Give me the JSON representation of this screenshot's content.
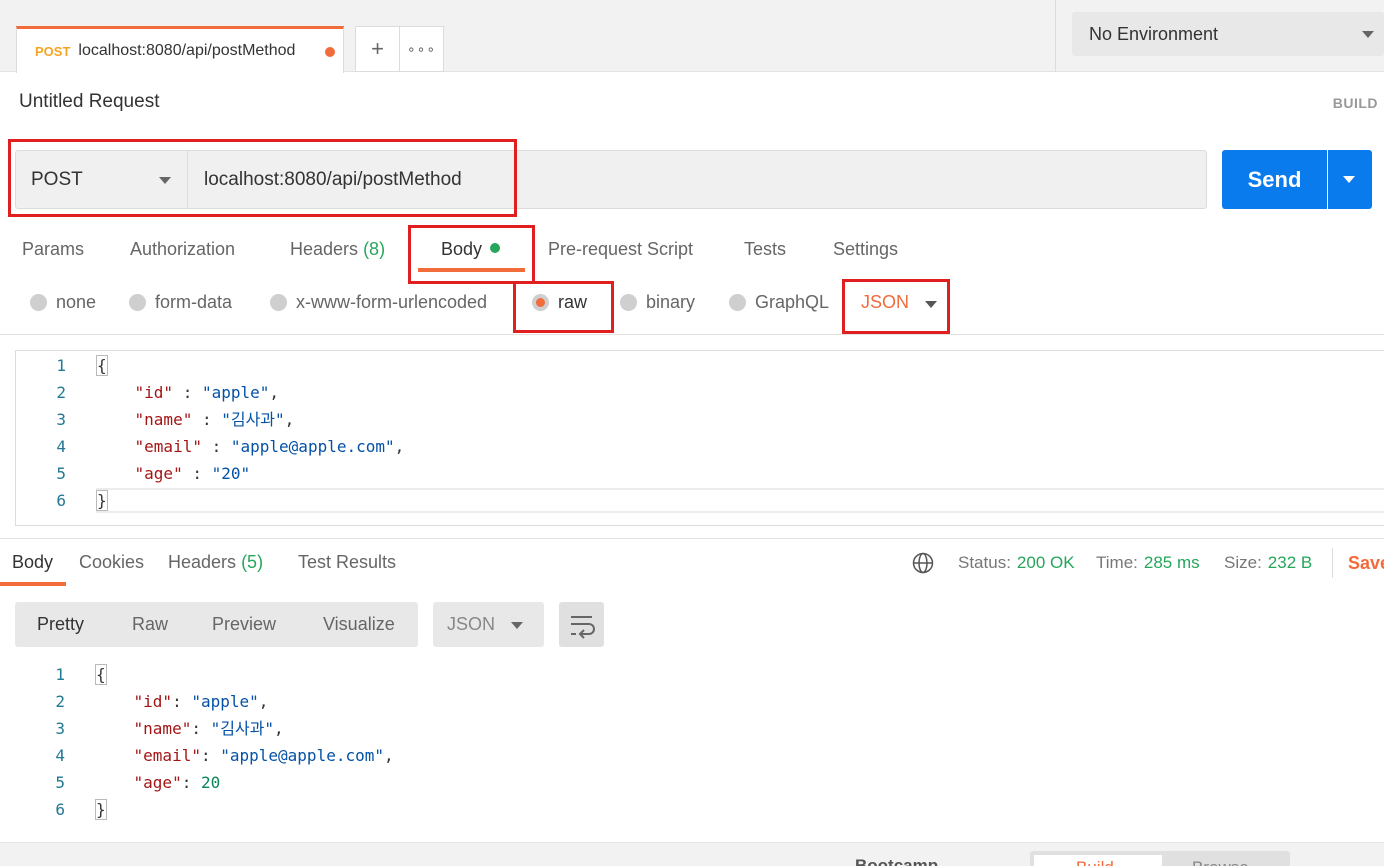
{
  "tab": {
    "method": "POST",
    "url": "localhost:8080/api/postMethod",
    "new_tab": "+",
    "more": "∘∘∘"
  },
  "environment": {
    "selected": "No Environment"
  },
  "request": {
    "title": "Untitled Request",
    "build_label": "BUILD",
    "method": "POST",
    "url": "localhost:8080/api/postMethod",
    "send_label": "Send",
    "tabs": {
      "params": "Params",
      "authorization": "Authorization",
      "headers": "Headers",
      "headers_count": "(8)",
      "body": "Body",
      "prerequest": "Pre-request Script",
      "tests": "Tests",
      "settings": "Settings"
    },
    "body_modes": {
      "none": "none",
      "form_data": "form-data",
      "urlencoded": "x-www-form-urlencoded",
      "raw": "raw",
      "binary": "binary",
      "graphql": "GraphQL",
      "selected": "raw"
    },
    "body_format": "JSON",
    "body_lines": [
      {
        "n": "1",
        "t": "{"
      },
      {
        "n": "2",
        "key": "\"id\"",
        "sep": " : ",
        "val": "\"apple\"",
        "end": ","
      },
      {
        "n": "3",
        "key": "\"name\"",
        "sep": " : ",
        "val": "\"김사과\"",
        "end": ","
      },
      {
        "n": "4",
        "key": "\"email\"",
        "sep": " : ",
        "val": "\"apple@apple.com\"",
        "end": ","
      },
      {
        "n": "5",
        "key": "\"age\"",
        "sep": " : ",
        "val": "\"20\"",
        "end": ""
      },
      {
        "n": "6",
        "t": "}"
      }
    ]
  },
  "response": {
    "tabs": {
      "body": "Body",
      "cookies": "Cookies",
      "headers": "Headers",
      "headers_count": "(5)",
      "test_results": "Test Results"
    },
    "status_label": "Status:",
    "status": "200 OK",
    "time_label": "Time:",
    "time": "285 ms",
    "size_label": "Size:",
    "size": "232 B",
    "save_label": "Save",
    "views": {
      "pretty": "Pretty",
      "raw": "Raw",
      "preview": "Preview",
      "visualize": "Visualize"
    },
    "format": "JSON",
    "body_lines": [
      {
        "n": "1",
        "t": "{"
      },
      {
        "n": "2",
        "key": "\"id\"",
        "sep": ": ",
        "val": "\"apple\"",
        "end": ","
      },
      {
        "n": "3",
        "key": "\"name\"",
        "sep": ": ",
        "val": "\"김사과\"",
        "end": ","
      },
      {
        "n": "4",
        "key": "\"email\"",
        "sep": ": ",
        "val": "\"apple@apple.com\"",
        "end": ","
      },
      {
        "n": "5",
        "key": "\"age\"",
        "sep": ": ",
        "num": "20",
        "end": ""
      },
      {
        "n": "6",
        "t": "}"
      }
    ]
  },
  "bottom": {
    "bootcamp": "Bootcamp",
    "build": "Build",
    "browse": "Browse"
  },
  "colors": {
    "accent": "#f26b3a",
    "send": "#097bed",
    "success": "#26a65b",
    "highlight": "#e02020"
  },
  "icons": {
    "globe": "globe-icon",
    "wrap": "wrap-lines-icon",
    "caret": "chevron-down-icon"
  }
}
